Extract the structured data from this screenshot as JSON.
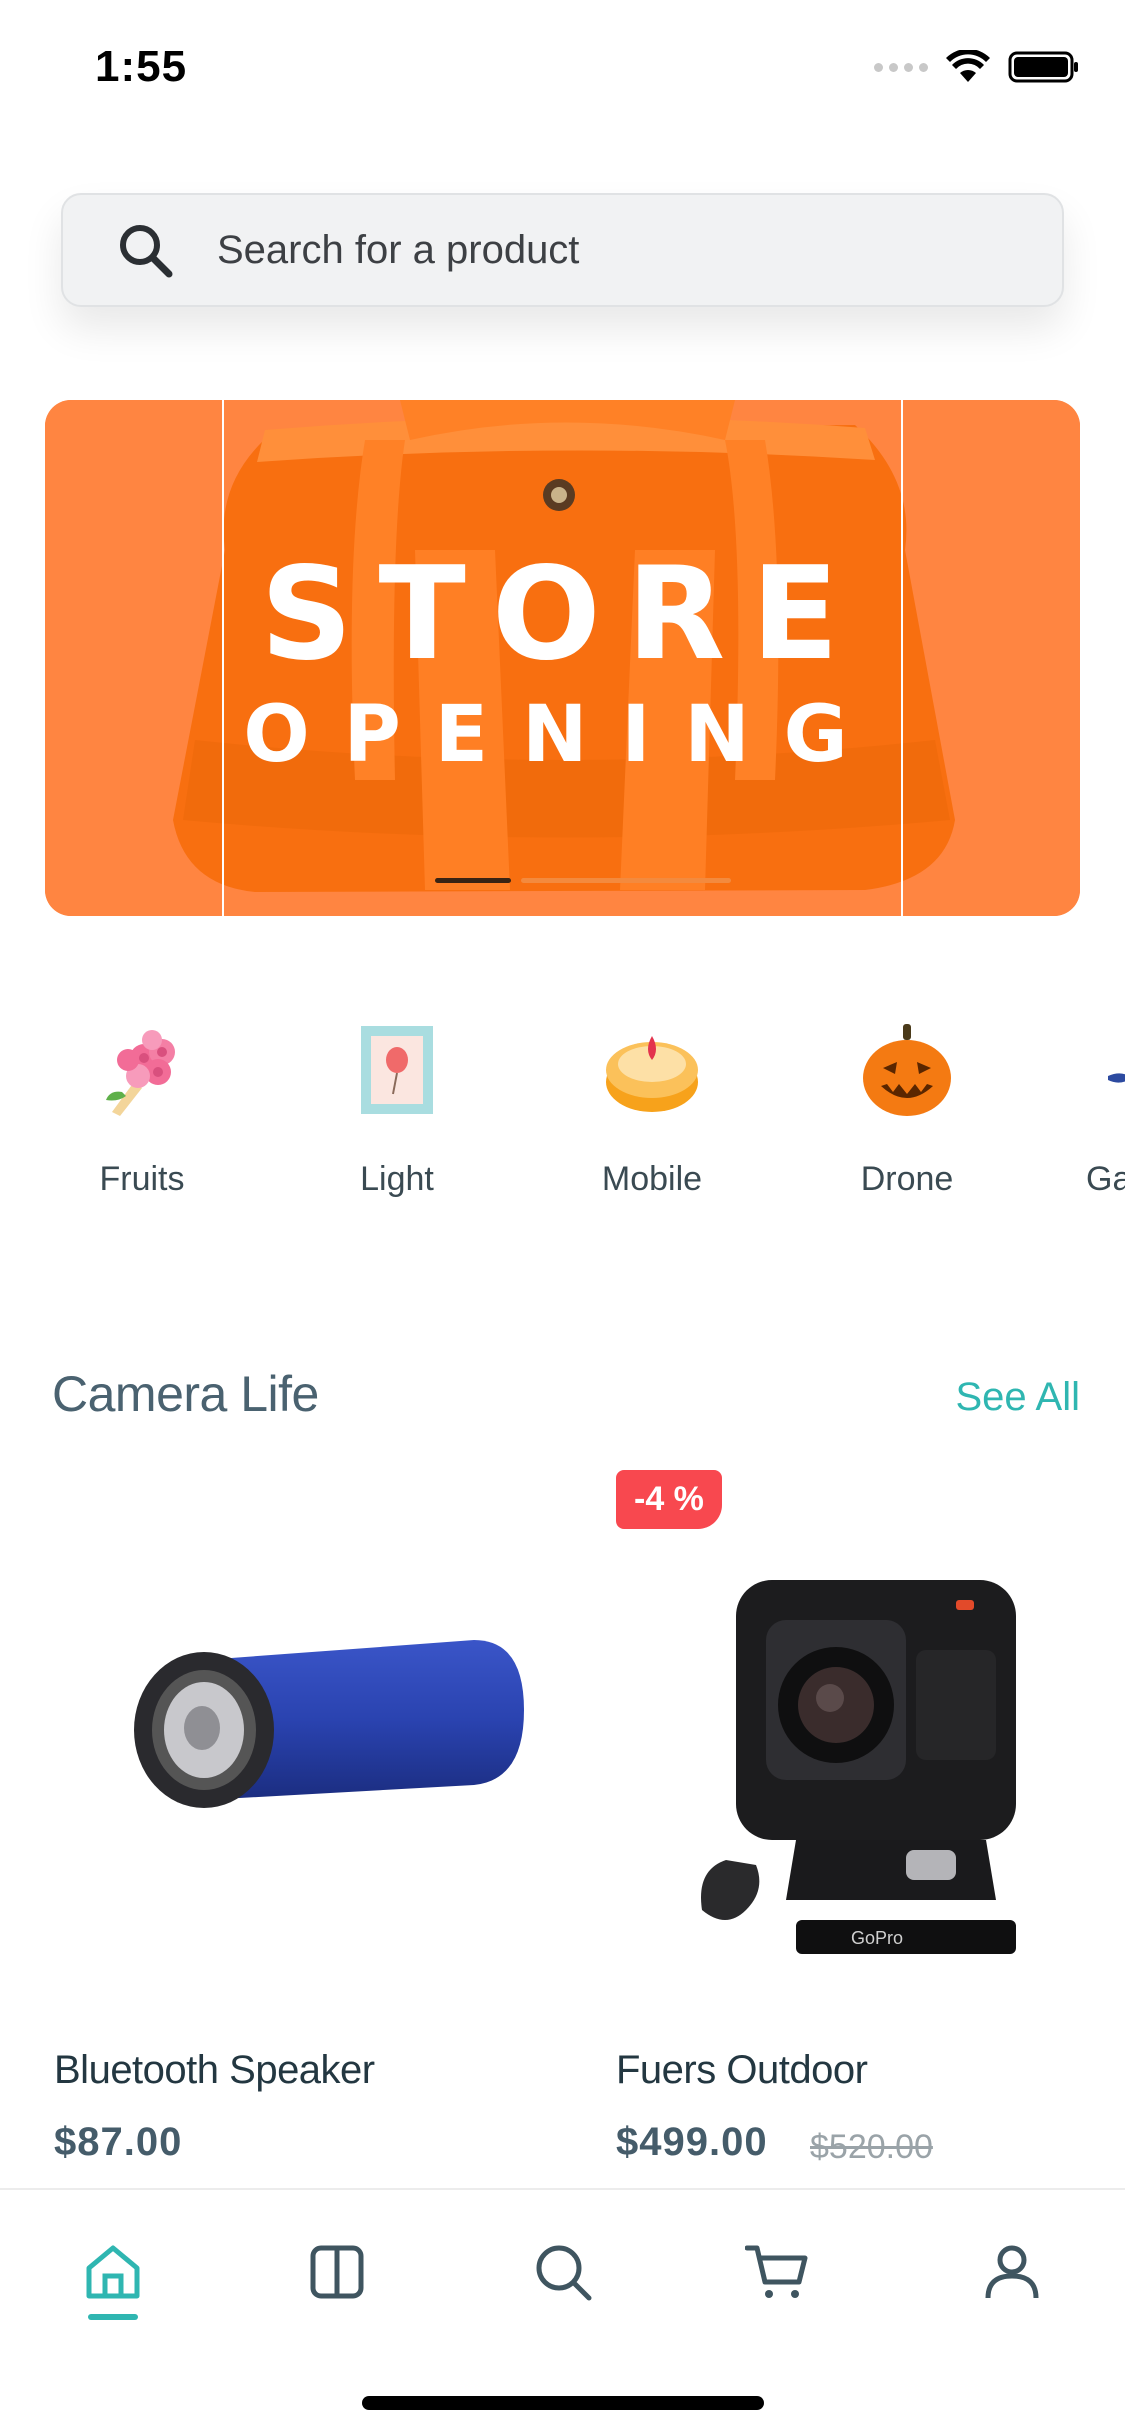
{
  "status_bar": {
    "time": "1:55"
  },
  "search": {
    "placeholder": "Search for a product"
  },
  "banner": {
    "line1": "STORE",
    "line2": "OPENING",
    "background_color": "#ff8541"
  },
  "categories": [
    {
      "label": "Fruits",
      "icon": "bouquet-icon"
    },
    {
      "label": "Light",
      "icon": "framed-picture-icon"
    },
    {
      "label": "Mobile",
      "icon": "dessert-icon"
    },
    {
      "label": "Drone",
      "icon": "pumpkin-icon"
    },
    {
      "label": "Ga",
      "icon": "partial-category-icon"
    }
  ],
  "section": {
    "title": "Camera Life",
    "see_all": "See All"
  },
  "products": [
    {
      "name": "Bluetooth Speaker",
      "price": "$87.00",
      "old_price": "",
      "discount": ""
    },
    {
      "name": "Fuers Outdoor",
      "price": "$499.00",
      "old_price": "$520.00",
      "discount": "-4 %"
    }
  ],
  "tabbar": {
    "items": [
      {
        "icon": "home-icon",
        "active": true
      },
      {
        "icon": "catalog-icon",
        "active": false
      },
      {
        "icon": "search-icon",
        "active": false
      },
      {
        "icon": "cart-icon",
        "active": false
      },
      {
        "icon": "profile-icon",
        "active": false
      }
    ],
    "accent_color": "#2fb6b1"
  }
}
